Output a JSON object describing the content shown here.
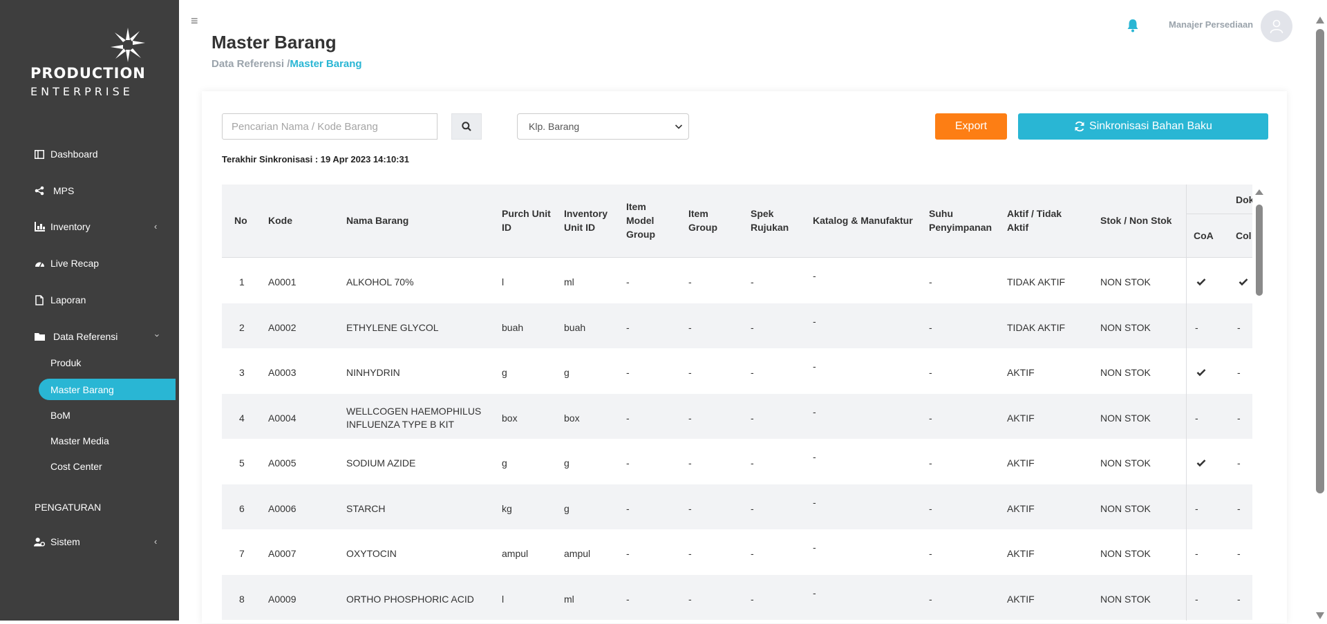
{
  "brand": {
    "line1": "PRODUCTION",
    "line2": "ENTERPRISE"
  },
  "sidebar": {
    "items": [
      {
        "label": "Dashboard",
        "icon": "columns-icon"
      },
      {
        "label": "MPS",
        "icon": "share-icon"
      },
      {
        "label": "Inventory",
        "icon": "chart-icon"
      },
      {
        "label": "Live Recap",
        "icon": "gauge-icon"
      },
      {
        "label": "Laporan",
        "icon": "file-icon"
      },
      {
        "label": "Data Referensi",
        "icon": "folder-icon"
      }
    ],
    "sub_items": [
      "Produk",
      "Master Barang",
      "BoM",
      "Master Media",
      "Cost Center"
    ],
    "section_title": "PENGATURAN",
    "system_label": "Sistem"
  },
  "header": {
    "title": "Master Barang",
    "breadcrumb_home": "Data Referensi /",
    "breadcrumb_current": "Master Barang",
    "user_name": "Manajer Persediaan"
  },
  "toolbar": {
    "search_placeholder": "Pencarian Nama / Kode Barang",
    "select_value": "Klp. Barang",
    "export_label": "Export",
    "sync_label": "Sinkronisasi Bahan Baku",
    "sync_info": "Terakhir Sinkronisasi : 19 Apr 2023 14:10:31"
  },
  "table": {
    "headers": {
      "no": "No",
      "kode": "Kode",
      "nama": "Nama Barang",
      "purch1": "Purch Unit",
      "purch2": "ID",
      "inv1": "Inventory",
      "inv2": "Unit ID",
      "imodel1": "Item",
      "imodel2": "Model",
      "imodel3": "Group",
      "igroup1": "Item",
      "igroup2": "Group",
      "spek1": "Spek",
      "spek2": "Rujukan",
      "katalog": "Katalog & Manufaktur",
      "suhu1": "Suhu",
      "suhu2": "Penyimpanan",
      "aktif1": "Aktif / Tidak",
      "aktif2": "Aktif",
      "stok": "Stok / Non Stok",
      "dok": "Dok",
      "coa": "CoA",
      "col": "Col"
    },
    "rows": [
      {
        "no": "1",
        "kode": "A0001",
        "nama": "ALKOHOL 70%",
        "nama2": "",
        "purch": "l",
        "inv": "ml",
        "model": "-",
        "group": "-",
        "spek": "-",
        "katalog": "-",
        "suhu": "-",
        "aktif": "TIDAK AKTIF",
        "stok": "NON STOK",
        "coa": "check",
        "col": "check"
      },
      {
        "no": "2",
        "kode": "A0002",
        "nama": "ETHYLENE GLYCOL",
        "nama2": "",
        "purch": "buah",
        "inv": "buah",
        "model": "-",
        "group": "-",
        "spek": "-",
        "katalog": "-",
        "suhu": "-",
        "aktif": "TIDAK AKTIF",
        "stok": "NON STOK",
        "coa": "-",
        "col": "-"
      },
      {
        "no": "3",
        "kode": "A0003",
        "nama": "NINHYDRIN",
        "nama2": "",
        "purch": "g",
        "inv": "g",
        "model": "-",
        "group": "-",
        "spek": "-",
        "katalog": "-",
        "suhu": "-",
        "aktif": "AKTIF",
        "stok": "NON STOK",
        "coa": "check",
        "col": "-"
      },
      {
        "no": "4",
        "kode": "A0004",
        "nama": "WELLCOGEN HAEMOPHILUS",
        "nama2": "INFLUENZA TYPE B KIT",
        "purch": "box",
        "inv": "box",
        "model": "-",
        "group": "-",
        "spek": "-",
        "katalog": "-",
        "suhu": "-",
        "aktif": "AKTIF",
        "stok": "NON STOK",
        "coa": "-",
        "col": "-"
      },
      {
        "no": "5",
        "kode": "A0005",
        "nama": "SODIUM AZIDE",
        "nama2": "",
        "purch": "g",
        "inv": "g",
        "model": "-",
        "group": "-",
        "spek": "-",
        "katalog": "-",
        "suhu": "-",
        "aktif": "AKTIF",
        "stok": "NON STOK",
        "coa": "check",
        "col": "-"
      },
      {
        "no": "6",
        "kode": "A0006",
        "nama": "STARCH",
        "nama2": "",
        "purch": "kg",
        "inv": "g",
        "model": "-",
        "group": "-",
        "spek": "-",
        "katalog": "-",
        "suhu": "-",
        "aktif": "AKTIF",
        "stok": "NON STOK",
        "coa": "-",
        "col": "-"
      },
      {
        "no": "7",
        "kode": "A0007",
        "nama": "OXYTOCIN",
        "nama2": "",
        "purch": "ampul",
        "inv": "ampul",
        "model": "-",
        "group": "-",
        "spek": "-",
        "katalog": "-",
        "suhu": "-",
        "aktif": "AKTIF",
        "stok": "NON STOK",
        "coa": "-",
        "col": "-"
      },
      {
        "no": "8",
        "kode": "A0009",
        "nama": "ORTHO PHOSPHORIC ACID",
        "nama2": "",
        "purch": "l",
        "inv": "ml",
        "model": "-",
        "group": "-",
        "spek": "-",
        "katalog": "-",
        "suhu": "-",
        "aktif": "AKTIF",
        "stok": "NON STOK",
        "coa": "-",
        "col": "-"
      }
    ]
  },
  "colors": {
    "accent": "#29b6d4",
    "export": "#fd7e14",
    "sidebar": "#3e3e3e"
  }
}
